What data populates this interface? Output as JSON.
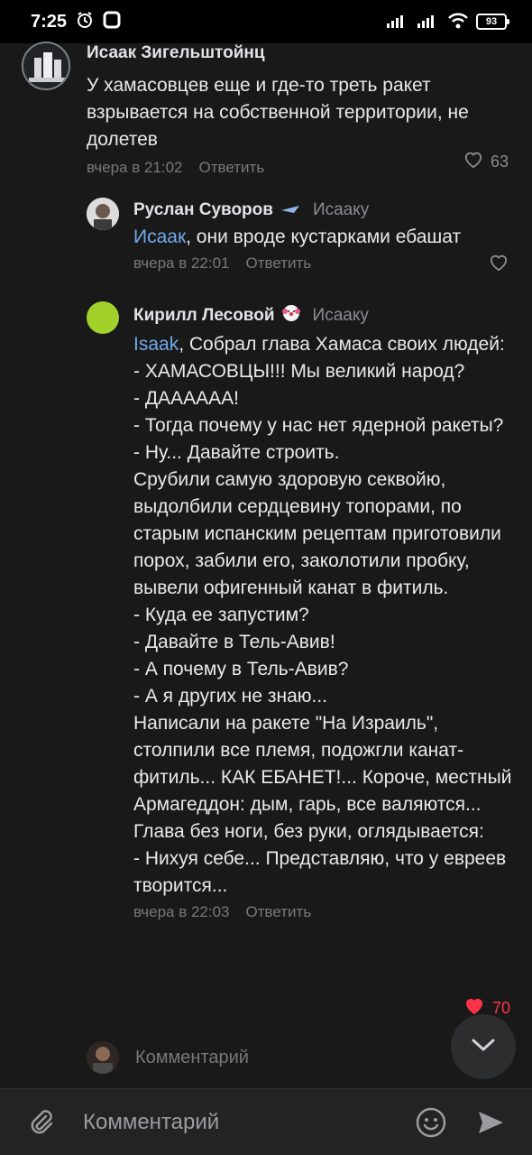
{
  "status": {
    "time": "7:25",
    "battery": "93"
  },
  "comments": [
    {
      "author": "Исаак Зигельштойнц",
      "text": "У хамасовцев еще и где-то треть ракет взрывается на собственной территории, не долетев",
      "time": "вчера в 21:02",
      "reply_label": "Ответить",
      "likes": "63"
    },
    {
      "author": "Руслан Суворов",
      "reply_to": "Исааку",
      "mention": "Исаак",
      "text": ", они вроде кустарками ебашат",
      "time": "вчера в 22:01",
      "reply_label": "Ответить"
    },
    {
      "author": "Кирилл Лесовой",
      "reply_to": "Исааку",
      "mention": "Isaak",
      "text": ", Собрал глава Хамаса своих людей:\n- ХАМАСОВЦЫ!!! Мы великий народ?\n- ДАААААА!\n- Тогда почему у нас нет ядерной ракеты?\n- Ну... Давайте строить.\nСрубили самую здоровую секвойю, выдолбили сердцевину топорами, по старым испанским рецептам приготовили порох, забили его, заколотили пробку, вывели офигенный канат в фитиль.\n- Куда ее запустим?\n- Давайте в Тель-Авив!\n- А почему в Тель-Авив?\n- А я других не знаю...\nНаписали на ракете \"На Израиль\", столпили все племя, подожгли канат-фитиль... КАК ЕБАНЕТ!... Короче, местный Армагеддон: дым, гарь, все валяются... Глава без ноги, без руки, оглядывается:\n- Нихуя себе... Представляю, что у евреев творится...",
      "time": "вчера в 22:03",
      "reply_label": "Ответить",
      "likes": "70"
    }
  ],
  "reply_placeholder": "Комментарий",
  "input_placeholder": "Комментарий",
  "colors": {
    "background": "#19191a",
    "link": "#71aaeb",
    "like_active": "#ff3347",
    "avatar_green": "#a3d12c"
  },
  "icons": [
    "alarm-icon",
    "app-icon",
    "signal-icon",
    "wifi-icon",
    "battery-icon",
    "heart-icon",
    "clown-emoji-icon",
    "plane-badge-icon",
    "chevron-down-icon",
    "attach-icon",
    "emoji-icon",
    "send-icon"
  ]
}
